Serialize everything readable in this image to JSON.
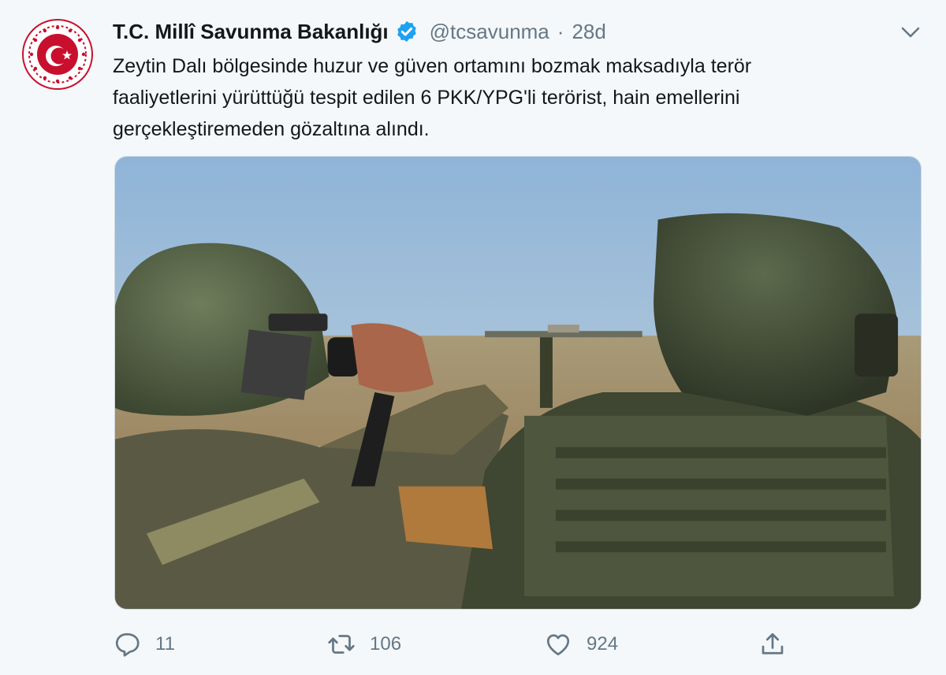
{
  "tweet": {
    "author_name": "T.C. Millî Savunma Bakanlığı",
    "handle": "@tcsavunma",
    "separator": "·",
    "time": "28d",
    "text_lines": [
      "Zeytin Dalı bölgesinde huzur ve güven ortamını bozmak maksadıyla terör",
      "faaliyetlerini yürüttüğü tespit edilen 6 PKK/YPG'li terörist, hain emellerini",
      "gerçekleştiremeden gözaltına alındı."
    ]
  },
  "actions": {
    "replies": "11",
    "retweets": "106",
    "likes": "924"
  },
  "icons": {
    "avatar": "ministry-emblem-icon",
    "verified": "verified-badge-icon",
    "menu": "chevron-down-icon",
    "reply": "reply-icon",
    "retweet": "retweet-icon",
    "like": "heart-icon",
    "share": "share-icon"
  },
  "colors": {
    "verified": "#1da1f2",
    "emblem_red": "#c8102e",
    "secondary_text": "#657786",
    "background": "#f5f8fa"
  }
}
